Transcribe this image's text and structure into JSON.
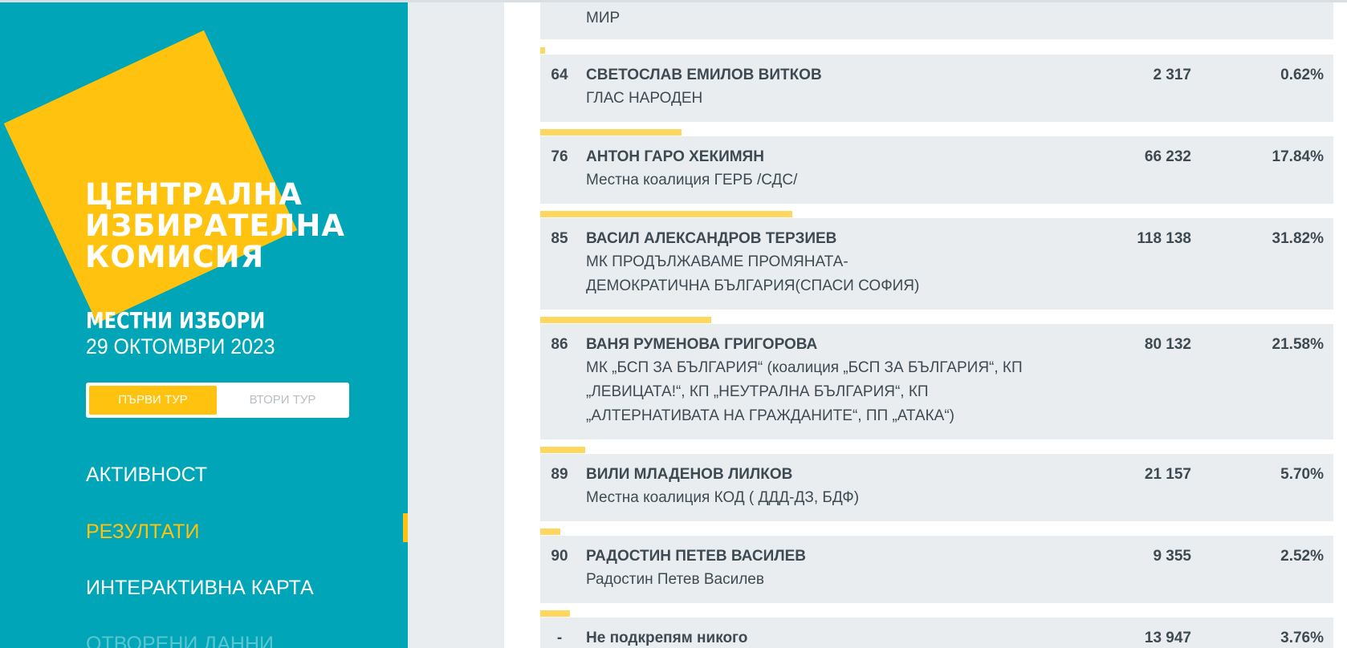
{
  "logo": {
    "lines": [
      "ЦЕНТРАЛНА",
      "ИЗБИРАТЕЛНА",
      "КОМИСИЯ"
    ]
  },
  "election": {
    "title": "МЕСТНИ ИЗБОРИ",
    "date": "29 ОКТОМВРИ 2023"
  },
  "tours": {
    "first": "ПЪРВИ ТУР",
    "second": "ВТОРИ ТУР"
  },
  "nav": {
    "turnout": "АКТИВНОСТ",
    "results": "РЕЗУЛТАТИ",
    "map": "ИНТЕРАКТИВНА КАРТА",
    "open_data": "ОТВОРЕНИ ДАННИ"
  },
  "colors": {
    "teal": "#00a6b7",
    "yellow": "#ffc20e",
    "row_bg": "#e9edf0",
    "text": "#3e4a52"
  },
  "results": {
    "partial_top": "МИР",
    "rows": [
      {
        "num": "64",
        "name": "СВЕТОСЛАВ ЕМИЛОВ ВИТКОВ",
        "party": "ГЛАС НАРОДЕН",
        "votes": "2 317",
        "pct": "0.62%",
        "share": 0.0062
      },
      {
        "num": "76",
        "name": "АНТОН ГАРО ХЕКИМЯН",
        "party": "Местна коалиция ГЕРБ /СДС/",
        "votes": "66 232",
        "pct": "17.84%",
        "share": 0.1784
      },
      {
        "num": "85",
        "name": "ВАСИЛ АЛЕКСАНДРОВ ТЕРЗИЕВ",
        "party": "МК ПРОДЪЛЖАВАМЕ ПРОМЯНАТА- ДЕМОКРАТИЧНА БЪЛГАРИЯ(СПАСИ СОФИЯ)",
        "votes": "118 138",
        "pct": "31.82%",
        "share": 0.3182
      },
      {
        "num": "86",
        "name": "ВАНЯ РУМЕНОВА ГРИГОРОВА",
        "party": "МК „БСП ЗА БЪЛГАРИЯ“ (коалиция „БСП ЗА БЪЛГАРИЯ“, КП „ЛЕВИЦАТА!“, КП „НЕУТРАЛНА БЪЛГАРИЯ“, КП „АЛТЕРНАТИВАТА НА ГРАЖДАНИТЕ“, ПП „АТАКА“)",
        "votes": "80 132",
        "pct": "21.58%",
        "share": 0.2158
      },
      {
        "num": "89",
        "name": "ВИЛИ МЛАДЕНОВ ЛИЛКОВ",
        "party": "Местна коалиция КОД ( ДДД-ДЗ, БДФ)",
        "votes": "21 157",
        "pct": "5.70%",
        "share": 0.057
      },
      {
        "num": "90",
        "name": "РАДОСТИН ПЕТЕВ ВАСИЛЕВ",
        "party": "Радостин Петев Василев",
        "votes": "9 355",
        "pct": "2.52%",
        "share": 0.0252
      },
      {
        "num": "-",
        "name": "Не подкрепям никого",
        "party": "",
        "votes": "13 947",
        "pct": "3.76%",
        "share": 0.0376
      }
    ]
  }
}
